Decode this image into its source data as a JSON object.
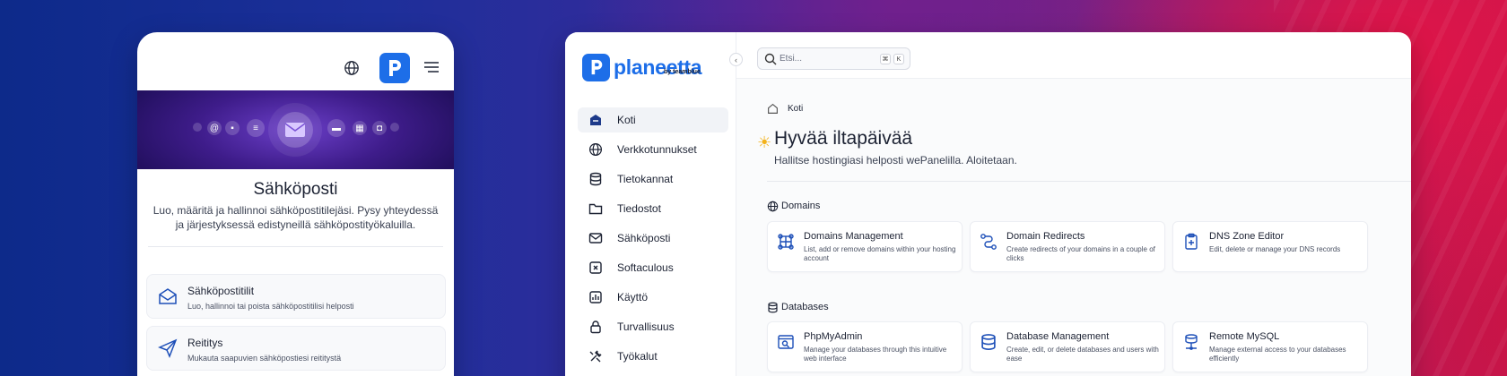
{
  "brand": {
    "name": "planeetta",
    "byline": "by teamblue",
    "accent": "#1d6ee8"
  },
  "phone": {
    "title": "Sähköposti",
    "description": "Luo, määritä ja hallinnoi sähköpostitilejäsi. Pysy yhteydessä ja järjestyksessä edistyneillä sähköpostityökaluilla.",
    "cards": [
      {
        "title": "Sähköpostitilit",
        "desc": "Luo, hallinnoi tai poista sähköpostitilisi helposti",
        "icon": "envelope-open-icon"
      },
      {
        "title": "Reititys",
        "desc": "Mukauta saapuvien sähköpostiesi reititystä",
        "icon": "send-icon"
      }
    ]
  },
  "search": {
    "placeholder": "Etsi...",
    "shortcut": [
      "⌘",
      "K"
    ]
  },
  "sidebar": {
    "items": [
      {
        "label": "Koti",
        "icon": "home-icon",
        "active": true
      },
      {
        "label": "Verkkotunnukset",
        "icon": "globe-icon"
      },
      {
        "label": "Tietokannat",
        "icon": "database-icon"
      },
      {
        "label": "Tiedostot",
        "icon": "folder-icon"
      },
      {
        "label": "Sähköposti",
        "icon": "mail-icon"
      },
      {
        "label": "Softaculous",
        "icon": "softaculous-icon"
      },
      {
        "label": "Käyttö",
        "icon": "chart-icon"
      },
      {
        "label": "Turvallisuus",
        "icon": "lock-icon"
      },
      {
        "label": "Työkalut",
        "icon": "tools-icon"
      }
    ]
  },
  "main": {
    "breadcrumb": "Koti",
    "greeting": "Hyvää iltapäivää",
    "subtitle": "Hallitse hostingiasi helposti wePanelilla. Aloitetaan.",
    "sections": [
      {
        "title": "Domains",
        "cards": [
          {
            "title": "Domains Management",
            "desc": "List, add or remove domains within your hosting account"
          },
          {
            "title": "Domain Redirects",
            "desc": "Create redirects of your domains in a couple of clicks"
          },
          {
            "title": "DNS Zone Editor",
            "desc": "Edit, delete or manage your DNS records"
          }
        ]
      },
      {
        "title": "Databases",
        "cards": [
          {
            "title": "PhpMyAdmin",
            "desc": "Manage your databases through this intuitive web interface"
          },
          {
            "title": "Database Management",
            "desc": "Create, edit, or delete databases and users with ease"
          },
          {
            "title": "Remote MySQL",
            "desc": "Manage external access to your databases efficiently"
          }
        ]
      }
    ]
  }
}
